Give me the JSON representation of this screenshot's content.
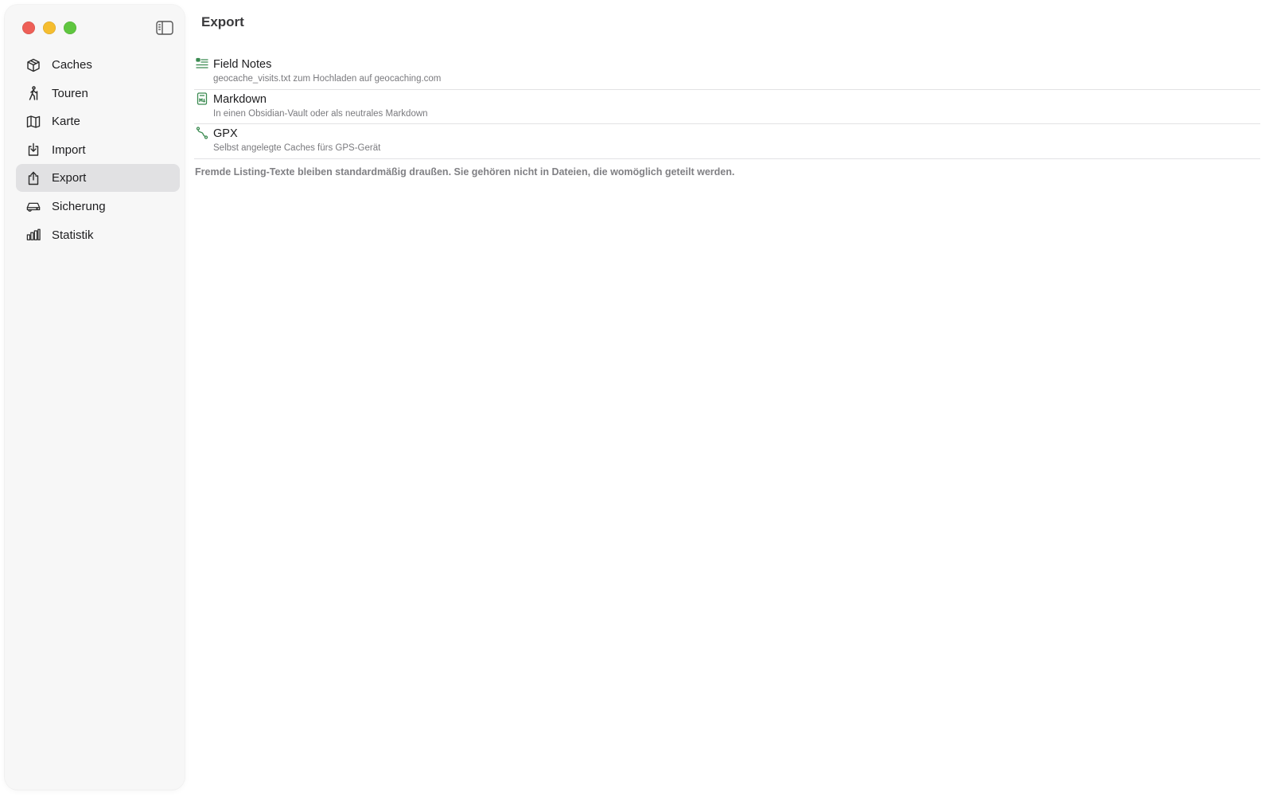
{
  "sidebar": {
    "items": [
      {
        "label": "Caches",
        "icon": "cube-icon"
      },
      {
        "label": "Touren",
        "icon": "hiker-icon"
      },
      {
        "label": "Karte",
        "icon": "map-icon"
      },
      {
        "label": "Import",
        "icon": "tray-in-icon"
      },
      {
        "label": "Export",
        "icon": "share-icon",
        "selected": true
      },
      {
        "label": "Sicherung",
        "icon": "backup-drive-icon"
      },
      {
        "label": "Statistik",
        "icon": "bar-chart-icon"
      }
    ]
  },
  "main": {
    "title": "Export",
    "rows": [
      {
        "title": "Field Notes",
        "subtitle": "geocache_visits.txt zum Hochladen auf geocaching.com",
        "icon": "checklist-icon"
      },
      {
        "title": "Markdown",
        "subtitle": "In einen Obsidian-Vault oder als neutrales Markdown",
        "icon": "markdown-doc-icon"
      },
      {
        "title": "GPX",
        "subtitle": "Selbst angelegte Caches fürs GPS-Gerät",
        "icon": "route-icon"
      }
    ],
    "footnote": "Fremde Listing-Texte bleiben standardmäßig draußen. Sie gehören nicht in Dateien, die womöglich geteilt werden."
  },
  "colors": {
    "accent_icon": "#3a8a50",
    "selection": "#e1e1e3",
    "sidebar_bg": "#f7f7f7"
  }
}
